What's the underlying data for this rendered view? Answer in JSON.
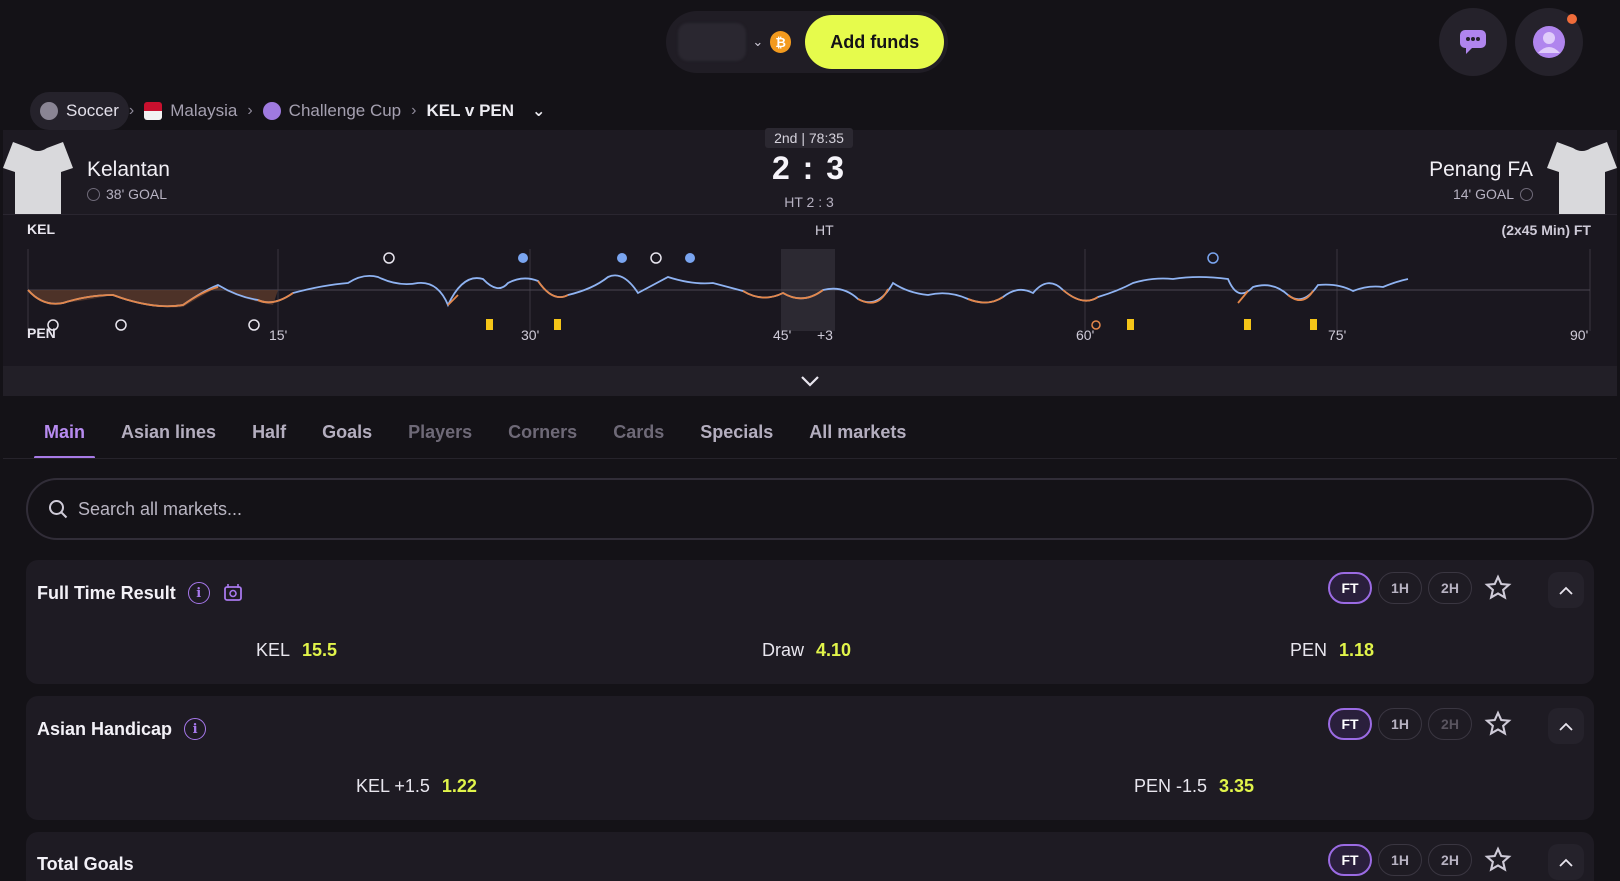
{
  "header": {
    "add_funds": "Add funds",
    "currency_icon": "bitcoin-icon",
    "chat_icon": "chat-icon",
    "user_icon": "user-icon",
    "notification_color": "#f06c3a"
  },
  "breadcrumb": {
    "items": [
      "Soccer",
      "Malaysia",
      "Challenge Cup",
      "KEL v PEN"
    ]
  },
  "match": {
    "clock": "2nd | 78:35",
    "home": {
      "name": "Kelantan",
      "note": "38' GOAL"
    },
    "away": {
      "name": "Penang FA",
      "note": "14' GOAL"
    },
    "score": "2 : 3",
    "half_time": "HT 2 : 3"
  },
  "timeline": {
    "home_abbr": "KEL",
    "away_abbr": "PEN",
    "ht_label": "HT",
    "ft_label": "(2x45 Min) FT",
    "ticks": [
      "15'",
      "30'",
      "45'",
      "+3",
      "60'",
      "75'",
      "90'"
    ]
  },
  "tabs": [
    {
      "label": "Main",
      "state": "active"
    },
    {
      "label": "Asian lines",
      "state": "normal"
    },
    {
      "label": "Half",
      "state": "normal"
    },
    {
      "label": "Goals",
      "state": "normal"
    },
    {
      "label": "Players",
      "state": "disabled"
    },
    {
      "label": "Corners",
      "state": "disabled"
    },
    {
      "label": "Cards",
      "state": "disabled"
    },
    {
      "label": "Specials",
      "state": "normal"
    },
    {
      "label": "All markets",
      "state": "normal"
    }
  ],
  "search": {
    "placeholder": "Search all markets..."
  },
  "markets": [
    {
      "title": "Full Time Result",
      "periods": [
        "FT",
        "1H",
        "2H"
      ],
      "odds": [
        {
          "selection": "KEL",
          "price": "15.5"
        },
        {
          "selection": "Draw",
          "price": "4.10"
        },
        {
          "selection": "PEN",
          "price": "1.18"
        }
      ]
    },
    {
      "title": "Asian Handicap",
      "periods": [
        "FT",
        "1H",
        "2H"
      ],
      "odds": [
        {
          "selection": "KEL +1.5",
          "price": "1.22"
        },
        {
          "selection": "PEN -1.5",
          "price": "3.35"
        }
      ]
    },
    {
      "title": "Total Goals",
      "periods": [
        "FT",
        "1H",
        "2H"
      ]
    }
  ]
}
